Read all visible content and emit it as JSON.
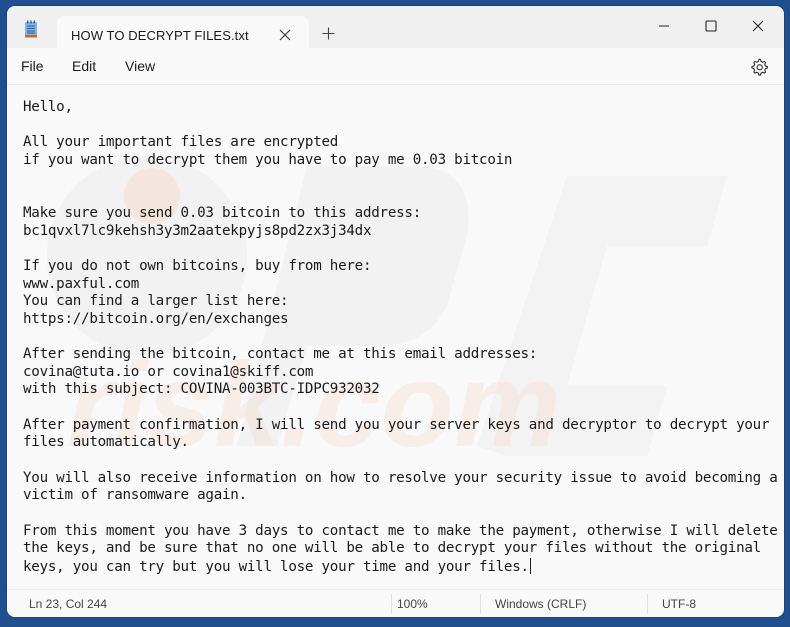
{
  "window": {
    "app_icon": "notepad-icon",
    "tab_title": "HOW TO DECRYPT FILES.txt",
    "tab_close_icon": "close-icon",
    "new_tab_icon": "plus-icon",
    "controls": {
      "minimize_icon": "minimize-icon",
      "maximize_icon": "maximize-icon",
      "close_icon": "close-icon"
    }
  },
  "menu": {
    "items": [
      "File",
      "Edit",
      "View"
    ],
    "settings_icon": "gear-icon"
  },
  "document": {
    "lines": [
      "Hello,",
      "",
      "All your important files are encrypted",
      "if you want to decrypt them you have to pay me 0.03 bitcoin",
      "",
      "",
      "Make sure you send 0.03 bitcoin to this address:",
      "bc1qvxl7lc9kehsh3y3m2aatekpyjs8pd2zx3j34dx",
      "",
      "If you do not own bitcoins, buy from here:",
      "www.paxful.com",
      "You can find a larger list here:",
      "https://bitcoin.org/en/exchanges",
      "",
      "After sending the bitcoin, contact me at this email addresses:",
      "covina@tuta.io or covina1@skiff.com",
      "with this subject: COVINA-003BTC-IDPC932032",
      "",
      "After payment confirmation, I will send you your server keys and decryptor to decrypt your",
      "files automatically.",
      "",
      "You will also receive information on how to resolve your security issue to avoid becoming a",
      "victim of ransomware again.",
      "",
      "From this moment you have 3 days to contact me to make the payment, otherwise I will delete",
      "the keys, and be sure that no one will be able to decrypt your files without the original",
      "keys, you can try but you will lose your time and your files."
    ]
  },
  "status": {
    "position": "Ln 23, Col 244",
    "zoom": "100%",
    "line_ending": "Windows (CRLF)",
    "encoding": "UTF-8"
  },
  "colors": {
    "desktop": "#1f4f8e",
    "window_bg": "#f9f9f9",
    "titlebar_bg": "#f0f0f0",
    "text": "#1a1a1a"
  }
}
